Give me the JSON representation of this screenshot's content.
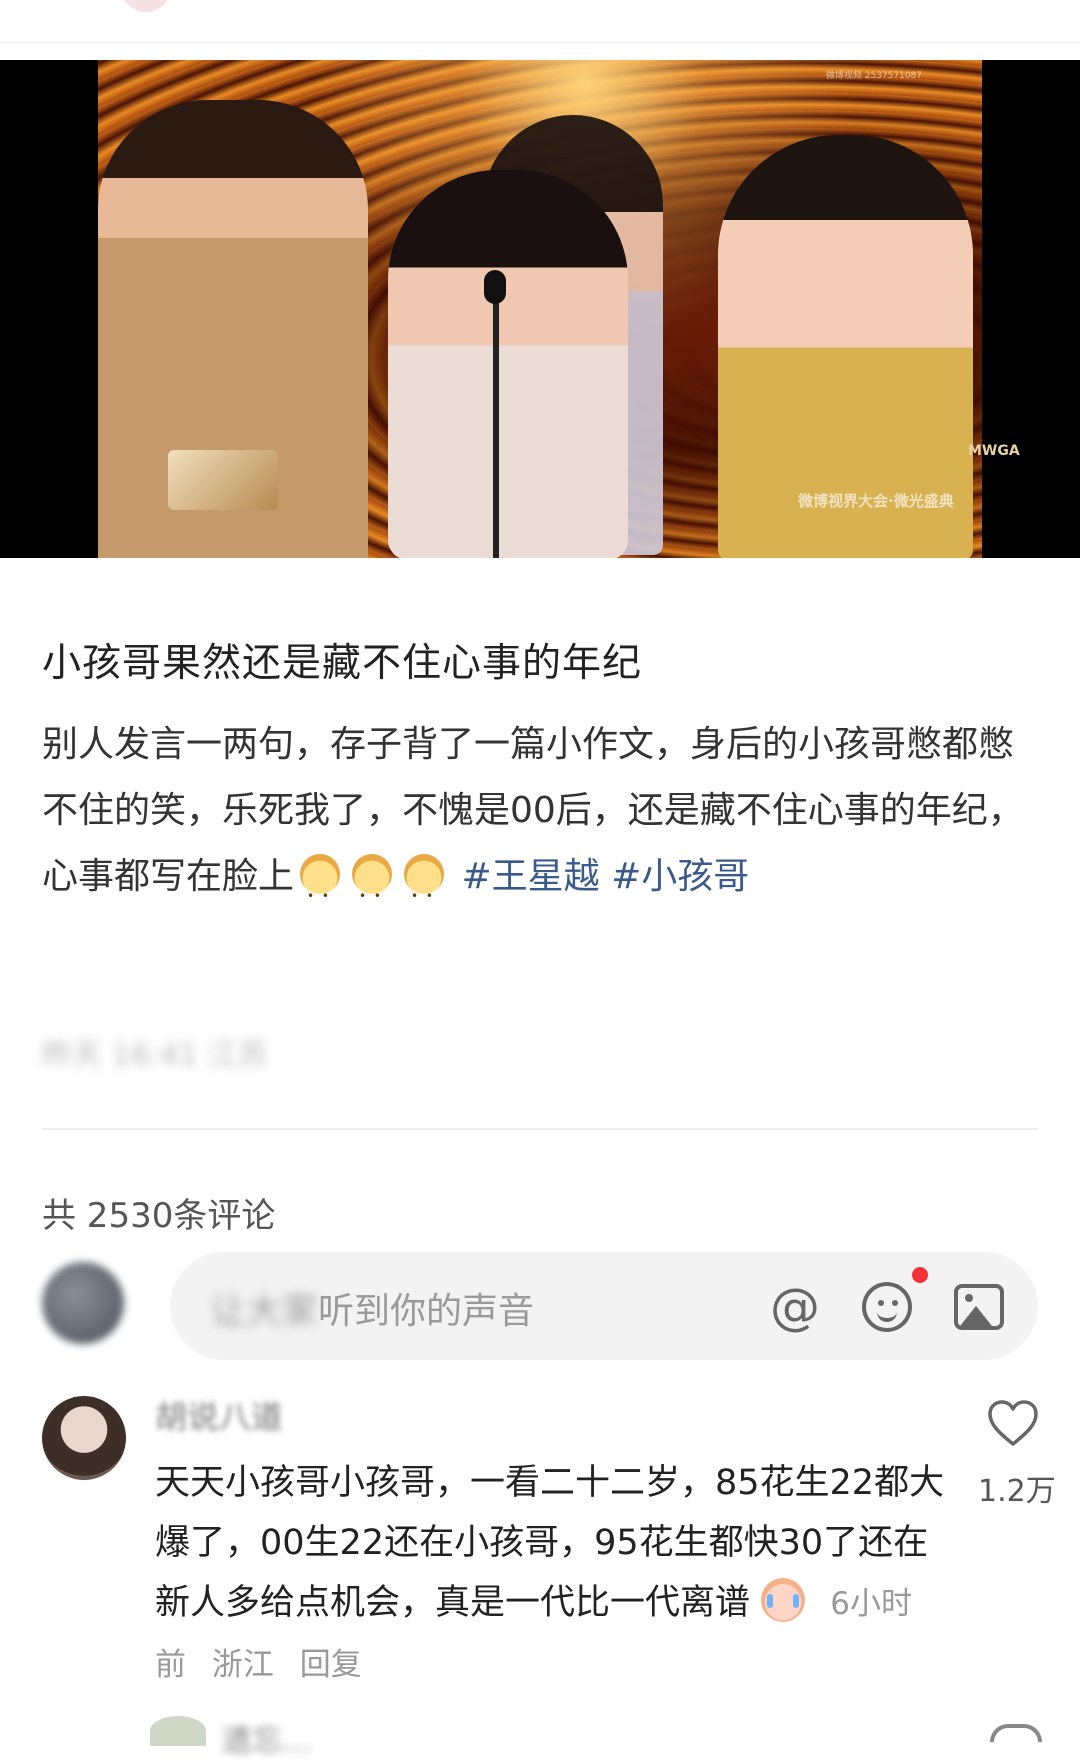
{
  "post": {
    "title": "小孩哥果然还是藏不住心事的年纪",
    "body_part1": "别人发言一两句，存子背了一篇小作文，身后的小孩哥憋都憋不住的笑，乐死我了，不愧是00后，还是藏不住心事的年纪，心事都写在脸上",
    "topic1": "#王星越",
    "topic2": "#小孩哥",
    "meta_blurred": "昨天 16:41 江苏",
    "media": {
      "logo": "MWGA",
      "banner": "微博视界大会·微光盛典",
      "watermark": "微博视频 2537571087"
    }
  },
  "comments": {
    "count_label": "共 2530条评论",
    "input_placeholder_blur": "让大家",
    "input_placeholder": "听到你的声音",
    "icons": [
      "at-icon",
      "emoji-icon",
      "image-icon"
    ],
    "items": [
      {
        "name": "胡说八道",
        "text": "天天小孩哥小孩哥，一看二十二岁，85花生22都大爆了，00生22还在小孩哥，95花生都快30了还在新人多给点机会，真是一代比一代离谱",
        "time": "6小时前",
        "location": "浙江",
        "reply": "回复",
        "likes": "1.2万"
      }
    ],
    "next_name": "遗忘…"
  }
}
